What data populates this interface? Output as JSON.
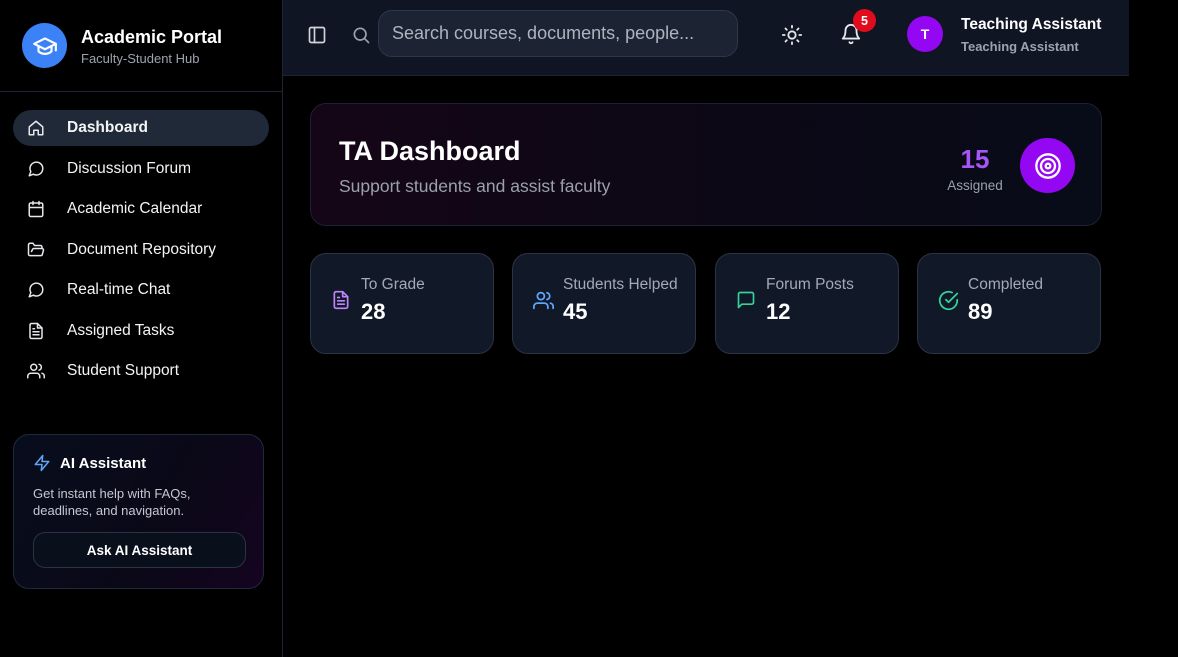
{
  "brand": {
    "title": "Academic Portal",
    "subtitle": "Faculty-Student Hub"
  },
  "sidebar": {
    "items": [
      {
        "label": "Dashboard",
        "icon": "home-icon",
        "active": true
      },
      {
        "label": "Discussion Forum",
        "icon": "message-circle-icon"
      },
      {
        "label": "Academic Calendar",
        "icon": "calendar-icon"
      },
      {
        "label": "Document Repository",
        "icon": "folder-open-icon"
      },
      {
        "label": "Real-time Chat",
        "icon": "message-circle-icon"
      },
      {
        "label": "Assigned Tasks",
        "icon": "file-text-icon"
      },
      {
        "label": "Student Support",
        "icon": "users-icon"
      }
    ]
  },
  "ai_card": {
    "icon": "zap-icon",
    "title": "AI Assistant",
    "description": "Get instant help with FAQs, deadlines, and navigation.",
    "button_label": "Ask AI Assistant"
  },
  "header": {
    "search_placeholder": "Search courses, documents, people...",
    "notification_count": "5",
    "user": {
      "initial": "T",
      "name": "Teaching Assistant",
      "role": "Teaching Assistant"
    }
  },
  "hero": {
    "title": "TA Dashboard",
    "subtitle": "Support students and assist faculty",
    "count": "15",
    "count_label": "Assigned",
    "icon": "target-icon"
  },
  "stats": [
    {
      "label": "To Grade",
      "value": "28",
      "icon": "file-text-icon",
      "color": "#c084fc"
    },
    {
      "label": "Students Helped",
      "value": "45",
      "icon": "users-icon",
      "color": "#60a5fa"
    },
    {
      "label": "Forum Posts",
      "value": "12",
      "icon": "message-square-icon",
      "color": "#34d399"
    },
    {
      "label": "Completed",
      "value": "89",
      "icon": "check-circle-icon",
      "color": "#34d399"
    }
  ],
  "colors": {
    "accent_blue": "#3b82f6",
    "accent_purple": "#9307f2",
    "badge_red": "#e00b1c"
  }
}
